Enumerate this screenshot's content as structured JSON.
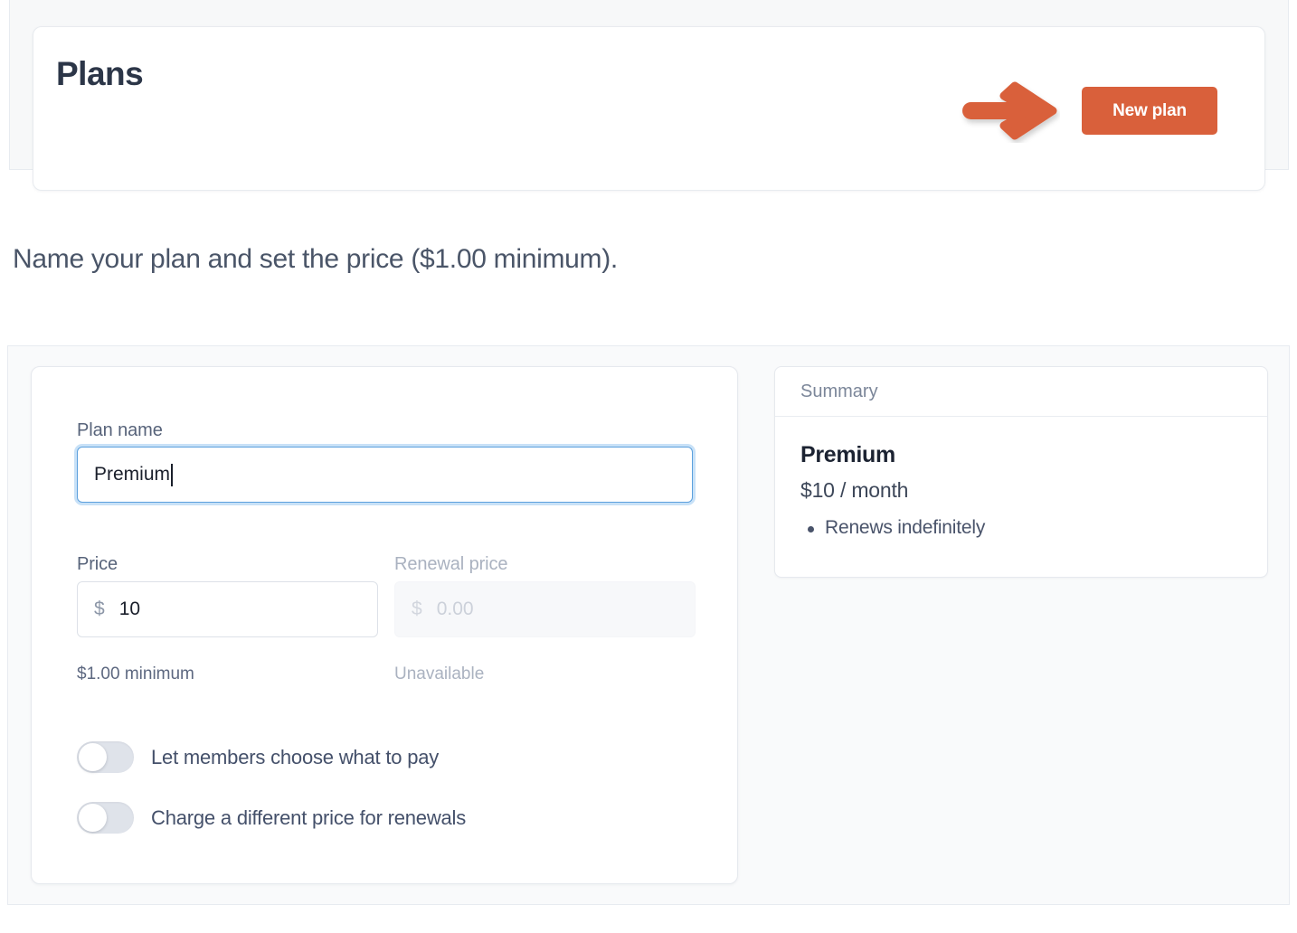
{
  "header": {
    "title": "Plans",
    "new_plan_label": "New plan",
    "annotation_icon": "right-arrow-annotation-icon",
    "accent_color": "#d9603b"
  },
  "instruction": {
    "text": "Name your plan and set the price ($1.00 minimum)."
  },
  "form": {
    "plan_name": {
      "label": "Plan name",
      "value": "Premium",
      "placeholder": "",
      "focused": true
    },
    "price": {
      "label": "Price",
      "symbol": "$",
      "value": "10",
      "helper": "$1.00 minimum"
    },
    "renewal_price": {
      "label": "Renewal price",
      "symbol": "$",
      "placeholder": "0.00",
      "helper": "Unavailable",
      "disabled": true
    },
    "toggles": [
      {
        "label": "Let members choose what to pay",
        "checked": false
      },
      {
        "label": "Charge a different price for renewals",
        "checked": false
      }
    ]
  },
  "summary": {
    "header": "Summary",
    "plan_name": "Premium",
    "price": "$10 / month",
    "bullets": [
      "Renews indefinitely"
    ]
  }
}
